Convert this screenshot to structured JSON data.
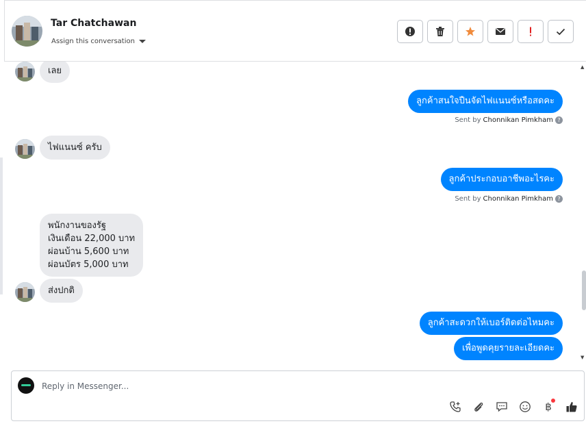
{
  "header": {
    "contact_name": "Tar Chatchawan",
    "assign_label": "Assign this conversation",
    "actions": [
      {
        "name": "spam-icon"
      },
      {
        "name": "trash-icon"
      },
      {
        "name": "star-icon",
        "color": "#f08b3c"
      },
      {
        "name": "envelope-icon"
      },
      {
        "name": "exclamation-icon",
        "color": "#e02020"
      },
      {
        "name": "check-icon"
      }
    ]
  },
  "thread": {
    "messages": [
      {
        "dir": "in",
        "text": "เลย",
        "avatar": true
      },
      {
        "dir": "out",
        "text": "ลูกค้าสนใจปืนจัดไฟแนนซ์หรือสดคะ"
      },
      {
        "dir": "out_meta",
        "sent_by_prefix": "Sent by",
        "sent_by_name": "Chonnikan Pimkham"
      },
      {
        "dir": "in",
        "text": "ไฟแนนซ์ ครับ",
        "avatar": true
      },
      {
        "dir": "out",
        "text": "ลูกค้าประกอบอาชีพอะไรคะ"
      },
      {
        "dir": "out_meta",
        "sent_by_prefix": "Sent by",
        "sent_by_name": "Chonnikan Pimkham"
      },
      {
        "dir": "in",
        "lines": [
          "พนักงานของรัฐ",
          "เงินเดือน 22,000 บาท",
          "ผ่อนบ้าน 5,600 บาท",
          "ผ่อนบัตร 5,000 บาท"
        ]
      },
      {
        "dir": "in",
        "text": "ส่งปกติ",
        "avatar": true
      },
      {
        "dir": "out",
        "text": "ลูกค้าสะดวกให้เบอร์ติดต่อไหมคะ"
      },
      {
        "dir": "out",
        "text": "เพื่อพูดคุยรายละเอียดคะ"
      }
    ]
  },
  "composer": {
    "placeholder": "Reply in Messenger...",
    "icons": [
      "phone-plus-icon",
      "paperclip-icon",
      "chat-bubble-icon",
      "smiley-icon",
      "baht-icon",
      "thumbs-up-icon"
    ],
    "baht_symbol": "฿"
  }
}
